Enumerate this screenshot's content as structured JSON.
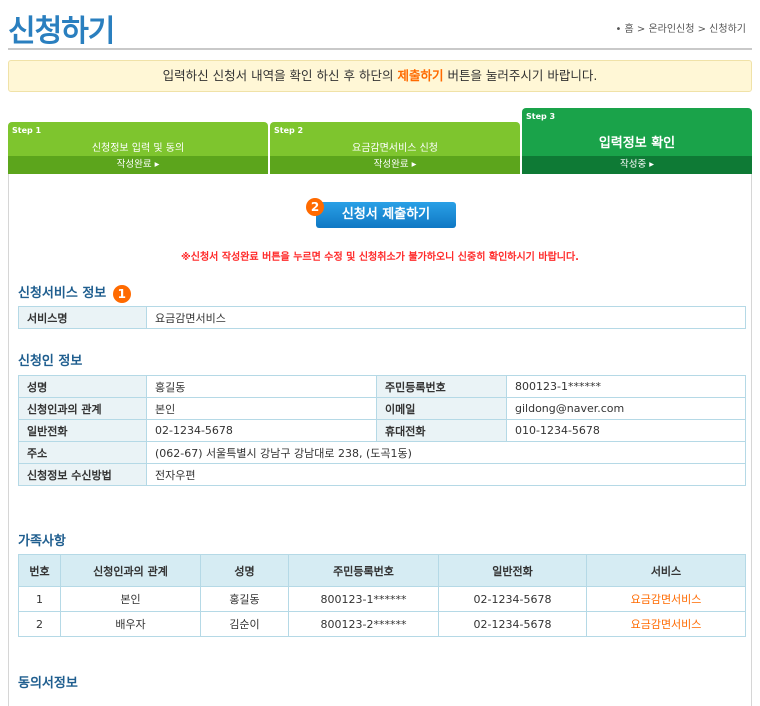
{
  "page": {
    "title": "신청하기",
    "breadcrumb": "• 홈 > 온라인신청 > 신청하기"
  },
  "notice": {
    "prefix": "입력하신 신청서 내역을 확인 하신 후 하단의 ",
    "highlight": "제출하기",
    "suffix": " 버튼을 눌러주시기 바랍니다."
  },
  "steps": [
    {
      "num": "Step 1",
      "label": "신청정보 입력 및 동의",
      "status": "작성완료 ▸"
    },
    {
      "num": "Step 2",
      "label": "요금감면서비스 신청",
      "status": "작성완료 ▸"
    },
    {
      "num": "Step 3",
      "label": "입력정보 확인",
      "status": "작성중 ▸"
    }
  ],
  "submit": {
    "badge": "2",
    "label": "신청서 제출하기"
  },
  "warning": "※신청서 작성완료 버튼을 누르면 수정 및 신청취소가 불가하오니 신중히 확인하시기 바랍니다.",
  "service_info": {
    "title": "신청서비스 정보",
    "badge": "1",
    "label": "서비스명",
    "value": "요금감면서비스"
  },
  "applicant": {
    "title": "신청인 정보",
    "rows": [
      {
        "l1": "성명",
        "v1": "홍길동",
        "l2": "주민등록번호",
        "v2": "800123-1******"
      },
      {
        "l1": "신청인과의 관계",
        "v1": "본인",
        "l2": "이메일",
        "v2": "gildong@naver.com"
      },
      {
        "l1": "일반전화",
        "v1": "02-1234-5678",
        "l2": "휴대전화",
        "v2": "010-1234-5678"
      }
    ],
    "address_label": "주소",
    "address_value": "(062-67) 서울특별시 강남구 강남대로 238, (도곡1동)",
    "receive_label": "신청정보 수신방법",
    "receive_value": "전자우편"
  },
  "family": {
    "title": "가족사항",
    "headers": [
      "번호",
      "신청인과의 관계",
      "성명",
      "주민등록번호",
      "일반전화",
      "서비스"
    ],
    "rows": [
      [
        "1",
        "본인",
        "홍길동",
        "800123-1******",
        "02-1234-5678",
        "요금감면서비스"
      ],
      [
        "2",
        "배우자",
        "김순이",
        "800123-2******",
        "02-1234-5678",
        "요금감면서비스"
      ]
    ]
  },
  "consent": {
    "title": "동의서정보"
  }
}
